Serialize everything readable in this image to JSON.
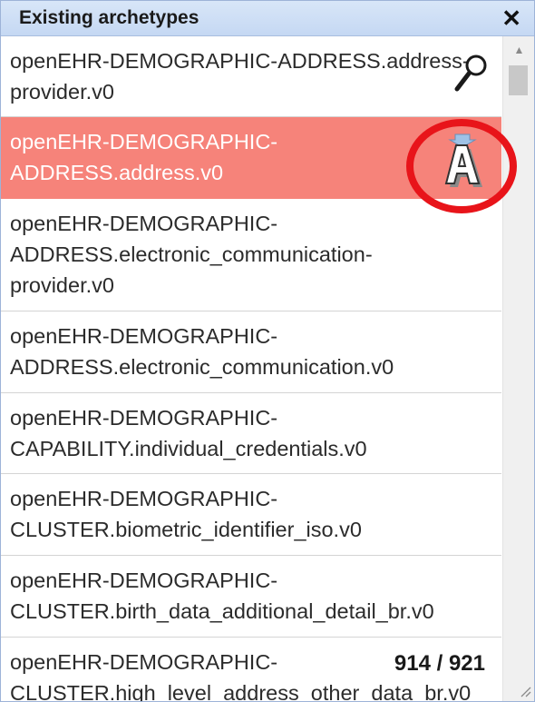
{
  "panel": {
    "title": "Existing archetypes"
  },
  "items": [
    {
      "lines": [
        "openEHR-DEMOGRAPHIC-ADDRESS.address-",
        "provider.v0"
      ],
      "selected": false
    },
    {
      "lines": [
        "openEHR-DEMOGRAPHIC-",
        "ADDRESS.address.v0"
      ],
      "selected": true
    },
    {
      "lines": [
        "openEHR-DEMOGRAPHIC-",
        "ADDRESS.electronic_communication-",
        "provider.v0"
      ],
      "selected": false
    },
    {
      "lines": [
        "openEHR-DEMOGRAPHIC-",
        "ADDRESS.electronic_communication.v0"
      ],
      "selected": false
    },
    {
      "lines": [
        "openEHR-DEMOGRAPHIC-",
        "CAPABILITY.individual_credentials.v0"
      ],
      "selected": false
    },
    {
      "lines": [
        "openEHR-DEMOGRAPHIC-",
        "CLUSTER.biometric_identifier_iso.v0"
      ],
      "selected": false
    },
    {
      "lines": [
        "openEHR-DEMOGRAPHIC-",
        "CLUSTER.birth_data_additional_detail_br.v0"
      ],
      "selected": false
    },
    {
      "lines": [
        "openEHR-DEMOGRAPHIC-",
        "CLUSTER.high_level_address_other_data_br.v0"
      ],
      "selected": false
    }
  ],
  "counter": "914 / 921",
  "icons": {
    "close": "close-icon",
    "search": "search-icon",
    "archetype": "archetype-a-icon",
    "scroll_up": "chevron-up-icon",
    "resize": "resize-grip-icon"
  },
  "colors": {
    "selected_row": "#f6837a",
    "title_bar": "#c5d8f3",
    "highlight_ring": "#e8141a"
  }
}
